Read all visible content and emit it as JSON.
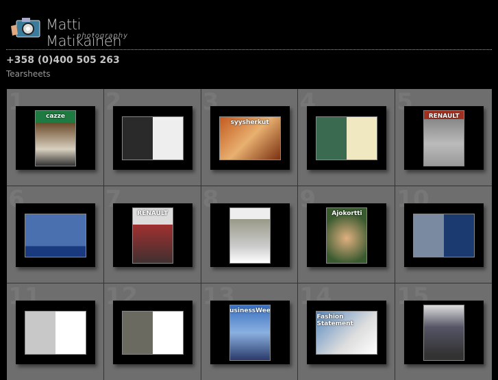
{
  "header": {
    "brand": "Matti Matikainen",
    "tagline": "photography",
    "phone": "+358 (0)400 505 263",
    "section": "Tearsheets"
  },
  "items": [
    {
      "number": "1",
      "label": "cazze",
      "kind": "portrait",
      "bg": "linear-gradient(#1e7a40 0 22%,#6a4a2a 22%,#d8d0c0 70%,#333)"
    },
    {
      "number": "2",
      "label": "",
      "kind": "spread",
      "bg": "linear-gradient(90deg,#2a2a2a 0 50%,#eee 50%)"
    },
    {
      "number": "3",
      "label": "syysherkut",
      "kind": "spread",
      "bg": "linear-gradient(135deg,#c45a20,#e8b070,#7a3010)"
    },
    {
      "number": "4",
      "label": "",
      "kind": "spread",
      "bg": "linear-gradient(90deg,#3a6a50 0 50%,#f0e8c0 50%)"
    },
    {
      "number": "5",
      "label": "RENAULT",
      "kind": "portrait",
      "bg": "linear-gradient(#a03020 0 15%,#888 15%,#bbb 60%,#999)"
    },
    {
      "number": "6",
      "label": "",
      "kind": "spread",
      "bg": "linear-gradient(#4a70b0 0 75%,#1a3a80 75%)"
    },
    {
      "number": "7",
      "label": "RENAULT",
      "kind": "portrait",
      "bg": "linear-gradient(#ddd 0 30%,#a03030 30%,#403030)"
    },
    {
      "number": "8",
      "label": "",
      "kind": "portrait",
      "bg": "linear-gradient(#eee 0 20%,#998 20%,#ccc 70%,#fff)"
    },
    {
      "number": "9",
      "label": "Ajokortti",
      "kind": "portrait",
      "bg": "radial-gradient(circle at 50% 55%,#e0b080,#3a5a30 70%)"
    },
    {
      "number": "10",
      "label": "",
      "kind": "spread",
      "bg": "linear-gradient(90deg,#7a8aa0 0 50%,#1a3a70 50%)"
    },
    {
      "number": "11",
      "label": "",
      "kind": "spread",
      "bg": "linear-gradient(90deg,#c8c8c8 0 50%,#fff 50%)"
    },
    {
      "number": "12",
      "label": "",
      "kind": "spread",
      "bg": "linear-gradient(90deg,#6a6a60 0 50%,#fff 50%)"
    },
    {
      "number": "13",
      "label": "BusinessWeek",
      "kind": "portrait",
      "bg": "linear-gradient(#3a70c0,#8ab0e0 50%,#2a3a6a)"
    },
    {
      "number": "14",
      "label": "Fashion Statement",
      "kind": "spread",
      "bg": "linear-gradient(135deg,#5a8ac0,#ddd 60%,#fff)"
    },
    {
      "number": "15",
      "label": "",
      "kind": "portrait",
      "bg": "linear-gradient(#ddd,#556 40%,#333 90%)"
    }
  ]
}
